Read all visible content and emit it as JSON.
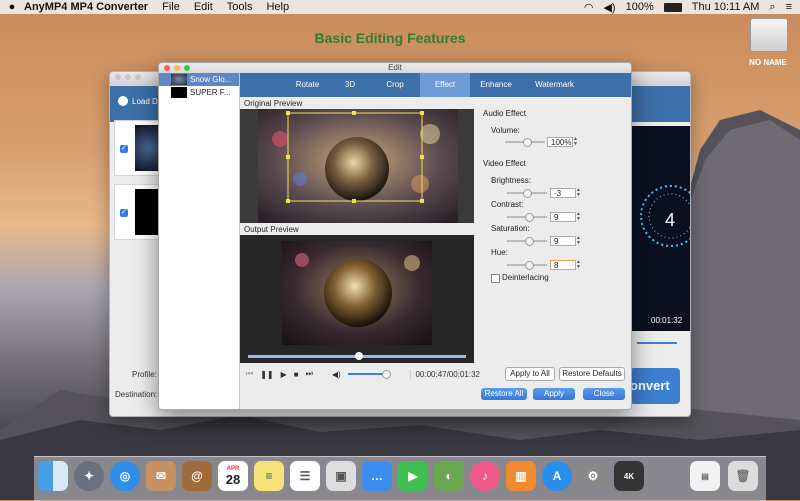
{
  "menubar": {
    "app_name": "AnyMP4 MP4 Converter",
    "menus": [
      "File",
      "Edit",
      "Tools",
      "Help"
    ],
    "battery": "100%",
    "clock": "Thu 10:11 AM"
  },
  "headline": "Basic Editing Features",
  "desktop": {
    "drive_label": "NO NAME"
  },
  "main_window": {
    "load_label": "Load Dis",
    "convert_label": "onvert",
    "time": "00:01:32",
    "profile_label": "Profile:",
    "destination_label": "Destination:"
  },
  "edit": {
    "title": "Edit",
    "files": [
      "Snow Glo...",
      "SUPER F..."
    ],
    "tabs": [
      "Rotate",
      "3D",
      "Crop",
      "Effect",
      "Enhance",
      "Watermark"
    ],
    "selected_tab": "Effect",
    "original_preview_label": "Original Preview",
    "output_preview_label": "Output Preview",
    "timecode": "00:00:47/00:01:32",
    "audio_effect_label": "Audio Effect",
    "volume_label": "Volume:",
    "volume_value": "100%",
    "video_effect_label": "Video Effect",
    "brightness_label": "Brightness:",
    "brightness_value": "-3",
    "contrast_label": "Contrast:",
    "contrast_value": "9",
    "saturation_label": "Saturation:",
    "saturation_value": "9",
    "hue_label": "Hue:",
    "hue_value": "8",
    "deinterlacing_label": "Deinterlacing",
    "apply_to_all": "Apply to All",
    "restore_defaults": "Restore Defaults",
    "restore_all": "Restore All",
    "apply": "Apply",
    "close": "Close",
    "progress_fraction": 0.51
  },
  "dock": {
    "calendar_month": "APR",
    "calendar_day": "28"
  }
}
